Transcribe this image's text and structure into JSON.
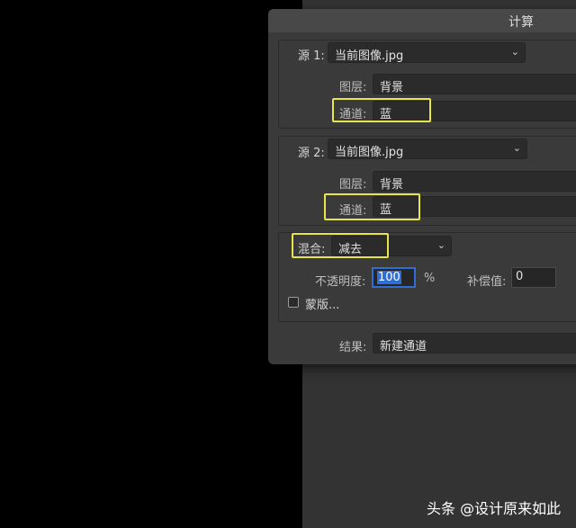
{
  "dialog": {
    "title": "计算"
  },
  "source1": {
    "label": "源 1:",
    "file": "当前图像.jpg",
    "layer_label": "图层:",
    "layer_value": "背景",
    "channel_label": "通道:",
    "channel_value": "蓝"
  },
  "source2": {
    "label": "源 2:",
    "file": "当前图像.jpg",
    "layer_label": "图层:",
    "layer_value": "背景",
    "channel_label": "通道:",
    "channel_value": "蓝"
  },
  "blend": {
    "label": "混合:",
    "value": "减去",
    "opacity_label": "不透明度:",
    "opacity_value": "100",
    "percent": "%",
    "offset_label": "补偿值:",
    "offset_value": "0",
    "mask_label": "蒙版..."
  },
  "result": {
    "label": "结果:",
    "value": "新建通道"
  },
  "watermark": {
    "text": "头条 @设计原来如此"
  },
  "colors": {
    "highlight": "#e6e64a",
    "accent": "#2d6fd6",
    "dialog_bg": "#3a3a3a"
  }
}
